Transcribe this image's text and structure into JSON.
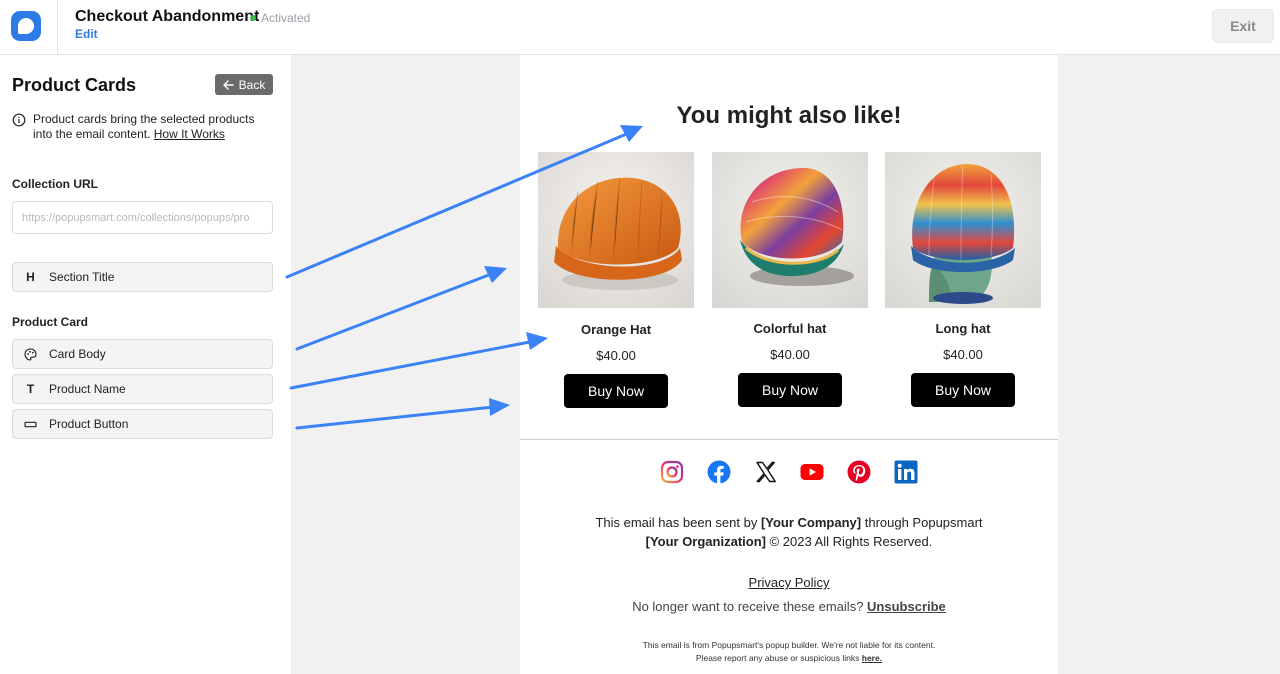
{
  "header": {
    "title": "Checkout Abandonment",
    "status": "Activated",
    "edit_label": "Edit",
    "exit_label": "Exit"
  },
  "sidebar": {
    "heading": "Product Cards",
    "back_label": "Back",
    "info_text": "Product cards bring the selected products into the email content.",
    "info_link": "How It Works",
    "collection_url_label": "Collection URL",
    "collection_url_placeholder": "https://popupsmart.com/collections/popups/pro",
    "section_title_item": "Section Title",
    "product_card_label": "Product Card",
    "items": [
      {
        "label": "Card Body",
        "icon": "palette-icon"
      },
      {
        "label": "Product Name",
        "icon": "text-icon"
      },
      {
        "label": "Product Button",
        "icon": "button-icon"
      }
    ]
  },
  "email": {
    "title": "You might also like!",
    "products": [
      {
        "name": "Orange Hat",
        "price": "$40.00",
        "button": "Buy Now",
        "image": "orange-beanie"
      },
      {
        "name": "Colorful hat",
        "price": "$40.00",
        "button": "Buy Now",
        "image": "colorful-beanie"
      },
      {
        "name": "Long hat",
        "price": "$40.00",
        "button": "Buy Now",
        "image": "striped-beanie-on-mannequin"
      }
    ],
    "social": [
      "instagram-icon",
      "facebook-icon",
      "x-icon",
      "youtube-icon",
      "pinterest-icon",
      "linkedin-icon"
    ],
    "sent_by_prefix": "This email has been sent by",
    "company": "[Your Company]",
    "sent_by_suffix": "through Popupsmart",
    "organization": "[Your Organization]",
    "copyright": "© 2023 All Rights Reserved.",
    "privacy": "Privacy Policy",
    "no_longer": "No longer want to receive these emails?",
    "unsubscribe": "Unsubscribe",
    "fine_1": "This email is from Popupsmart's popup builder. We're not liable for its content.",
    "fine_2": "Please report any abuse or suspicious links",
    "fine_link": "here."
  },
  "colors": {
    "accent": "#2e7be6",
    "arrow": "#3b82f6",
    "button": "#000000"
  }
}
